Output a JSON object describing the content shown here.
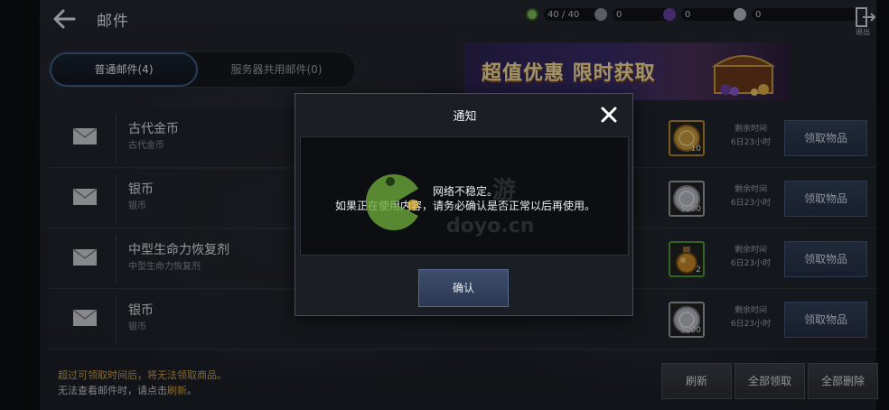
{
  "header": {
    "title": "邮件",
    "exit_label": "退出",
    "resources": [
      {
        "icon": "stamina-icon",
        "color": "#7fbf5a",
        "value": "40 / 40"
      },
      {
        "icon": "silver-coin-icon",
        "color": "#8a8f98",
        "value": "0"
      },
      {
        "icon": "purple-gem-icon",
        "color": "#6b3fa8",
        "value": "0"
      },
      {
        "icon": "grey-gem-icon",
        "color": "#b6bac2",
        "value": "0"
      }
    ]
  },
  "tabs": [
    {
      "label": "普通邮件(4)",
      "active": true
    },
    {
      "label": "服务器共用邮件(0)",
      "active": false
    }
  ],
  "banner": {
    "text": "超值优惠 限时获取"
  },
  "mails": [
    {
      "name": "古代金币",
      "sub": "古代金币",
      "item_icon": "gold-coin-icon",
      "qty": "10",
      "time_label": "剩余时间",
      "time_value": "6日23小时",
      "claim_label": "领取物品"
    },
    {
      "name": "银币",
      "sub": "银币",
      "item_icon": "silver-coin-icon",
      "qty": "5000",
      "time_label": "剩余时间",
      "time_value": "6日23小时",
      "claim_label": "领取物品"
    },
    {
      "name": "中型生命力恢复剂",
      "sub": "中型生命力恢复剂",
      "item_icon": "potion-icon",
      "qty": "2",
      "time_label": "剩余时间",
      "time_value": "6日23小时",
      "claim_label": "领取物品"
    },
    {
      "name": "银币",
      "sub": "银币",
      "item_icon": "silver-coin-icon",
      "qty": "5000",
      "time_label": "剩余时间",
      "time_value": "6日23小时",
      "claim_label": "领取物品"
    }
  ],
  "footer": {
    "note_line1": "超过可领取时间后，将无法领取商品。",
    "note_line2_prefix": "无法查看邮件时，请点击",
    "note_line2_link": "刷新",
    "note_line2_suffix": "。",
    "buttons": {
      "refresh": "刷新",
      "claim_all": "全部领取",
      "delete_all": "全部删除"
    }
  },
  "modal": {
    "title": "通知",
    "message_line1": "网络不稳定。",
    "message_line2": "如果正在使用内容，请务必确认是否正常以后再使用。",
    "confirm_label": "确认"
  },
  "watermark": {
    "cn": "游",
    "url": "doyo.cn"
  },
  "colors": {
    "accent_blue": "#3f5e86",
    "gold_text": "#d0a34a",
    "button_blue": "#33415b"
  }
}
